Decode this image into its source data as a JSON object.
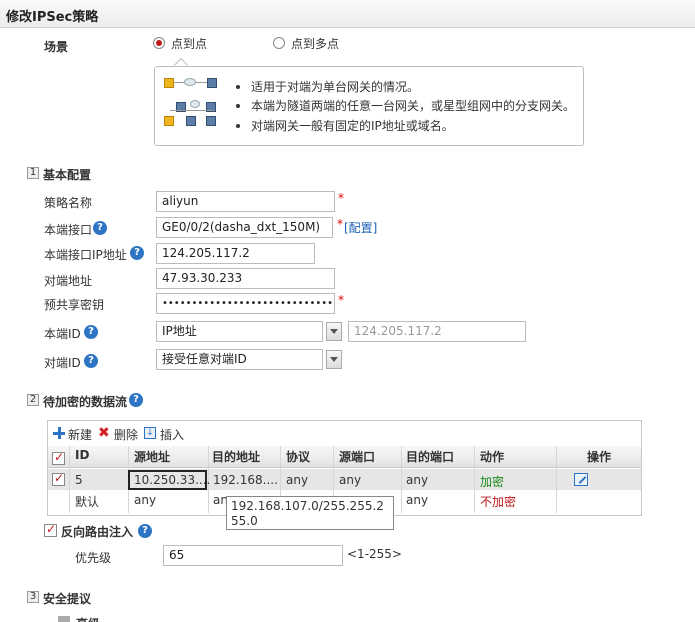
{
  "title": "修改IPSec策略",
  "scenario": {
    "label": "场景",
    "options": [
      {
        "label": "点到点",
        "selected": true
      },
      {
        "label": "点到多点",
        "selected": false
      }
    ],
    "info_lines": [
      "适用于对端为单台网关的情况。",
      "本端为隧道两端的任意一台网关，或星型组网中的分支网关。",
      "对端网关一般有固定的IP地址或域名。"
    ]
  },
  "section1": {
    "num": "1",
    "title": "基本配置",
    "policy_name": {
      "label": "策略名称",
      "value": "aliyun"
    },
    "local_if": {
      "label": "本端接口",
      "value": "GE0/0/2(dasha_dxt_150M)",
      "config_link": "[配置]"
    },
    "local_ip": {
      "label": "本端接口IP地址",
      "value": "124.205.117.2"
    },
    "peer_addr": {
      "label": "对端地址",
      "value": "47.93.30.233"
    },
    "psk": {
      "label": "预共享密钥",
      "value": "••••••••••••••••••••••••••••••••"
    },
    "local_id": {
      "label": "本端ID",
      "type": "IP地址",
      "value": "124.205.117.2"
    },
    "peer_id": {
      "label": "对端ID",
      "value": "接受任意对端ID"
    }
  },
  "section2": {
    "num": "2",
    "title": "待加密的数据流",
    "toolbar": {
      "new": "新建",
      "delete": "删除",
      "insert": "插入"
    },
    "columns": [
      "ID",
      "源地址",
      "目的地址",
      "协议",
      "源端口",
      "目的端口",
      "动作",
      "操作"
    ],
    "rows": [
      {
        "id": "5",
        "src": "10.250.33....",
        "dst": "192.168....",
        "proto": "any",
        "sport": "any",
        "dport": "any",
        "action": "加密",
        "checked": true
      },
      {
        "id": "默认",
        "src": "any",
        "dst": "an",
        "proto": "",
        "sport": "",
        "dport": "any",
        "action": "不加密",
        "checked": false
      }
    ],
    "tooltip": "192.168.107.0/255.255.255.0",
    "reverse_route": {
      "label": "反向路由注入",
      "checked": true
    },
    "priority": {
      "label": "优先级",
      "value": "65",
      "range": "<1-255>"
    }
  },
  "section3": {
    "num": "3",
    "title": "安全提议",
    "partial_label": "高级"
  },
  "colors": {
    "required": "#e30000",
    "encrypt": "#1a8a1a",
    "no_encrypt": "#c0171c",
    "link": "#1a5fb4",
    "help": "#2d75c4"
  }
}
